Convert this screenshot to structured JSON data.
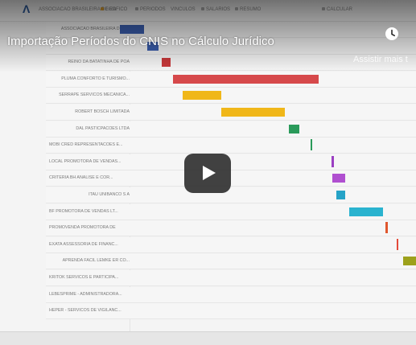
{
  "video": {
    "title": "Importação Períodos do CNIS no Cálculo Jurídico",
    "watch_later_label": "Assistir mais t",
    "colors": {
      "overlay": "#000000",
      "play_button": "#212121"
    }
  },
  "app_toolbar": {
    "tabs": [
      "ASSOCIACAO BRASILEIRA DE ED",
      "GRAFICO",
      "PERIODOS",
      "VINCULOS",
      "SALARIOS",
      "RESUMO",
      "CALCULAR"
    ]
  },
  "gantt": {
    "rows": [
      {
        "label": "ASSOCIACAO BRASILEIRA DE ED",
        "align": "right",
        "color": "#3b5fb0"
      },
      {
        "label": "",
        "align": "right",
        "color": "#3b5fb0"
      },
      {
        "label": "REINO DA BATATINHA DE POA",
        "align": "right",
        "color": "#c9393b"
      },
      {
        "label": "PLUMA CONFORTO E TURISMO...",
        "align": "right",
        "color": "#d6494b"
      },
      {
        "label": "SERRAPE SERVICOS MECANICA...",
        "align": "right",
        "color": "#f0b719"
      },
      {
        "label": "ROBERT BOSCH LIMITADA",
        "align": "right",
        "color": "#f0b719"
      },
      {
        "label": "DAL PASTICPACOES LTDA",
        "align": "right",
        "color": "#2a9a5a"
      },
      {
        "label": "MOBI CRED REPRESENTACOES E...",
        "align": "left",
        "color": "#2a9a5a"
      },
      {
        "label": "LOCAL PROMOTORA DE VENDAS...",
        "align": "left",
        "color": "#9b3fc2"
      },
      {
        "label": "CRITERIA BH ANALISE E COR...",
        "align": "left",
        "color": "#b04fd0"
      },
      {
        "label": "ITAU UNIBANCO S A",
        "align": "right",
        "color": "#25a3c7"
      },
      {
        "label": "BF PROMOTORA DE VENDAS LT...",
        "align": "left",
        "color": "#2ab3cf"
      },
      {
        "label": "PROMOVENDA PROMOTORA DE",
        "align": "left",
        "color": "#e0572e"
      },
      {
        "label": "EXATA ASSESSORIA DE FINANC...",
        "align": "left",
        "color": "#e34a3a"
      },
      {
        "label": "APRENDA FACIL LEMKE ER CO...",
        "align": "right",
        "color": "#9da11c"
      },
      {
        "label": "KRITOK SERVICOS E PARTICIPA...",
        "align": "left",
        "color": "#9da11c"
      },
      {
        "label": "LEBESPRIME - ADMINISTRADORA...",
        "align": "left",
        "color": "#9da11c"
      },
      {
        "label": "HEPER - SERVICOS DE VIGILANC...",
        "align": "left",
        "color": "#9da11c"
      }
    ]
  }
}
